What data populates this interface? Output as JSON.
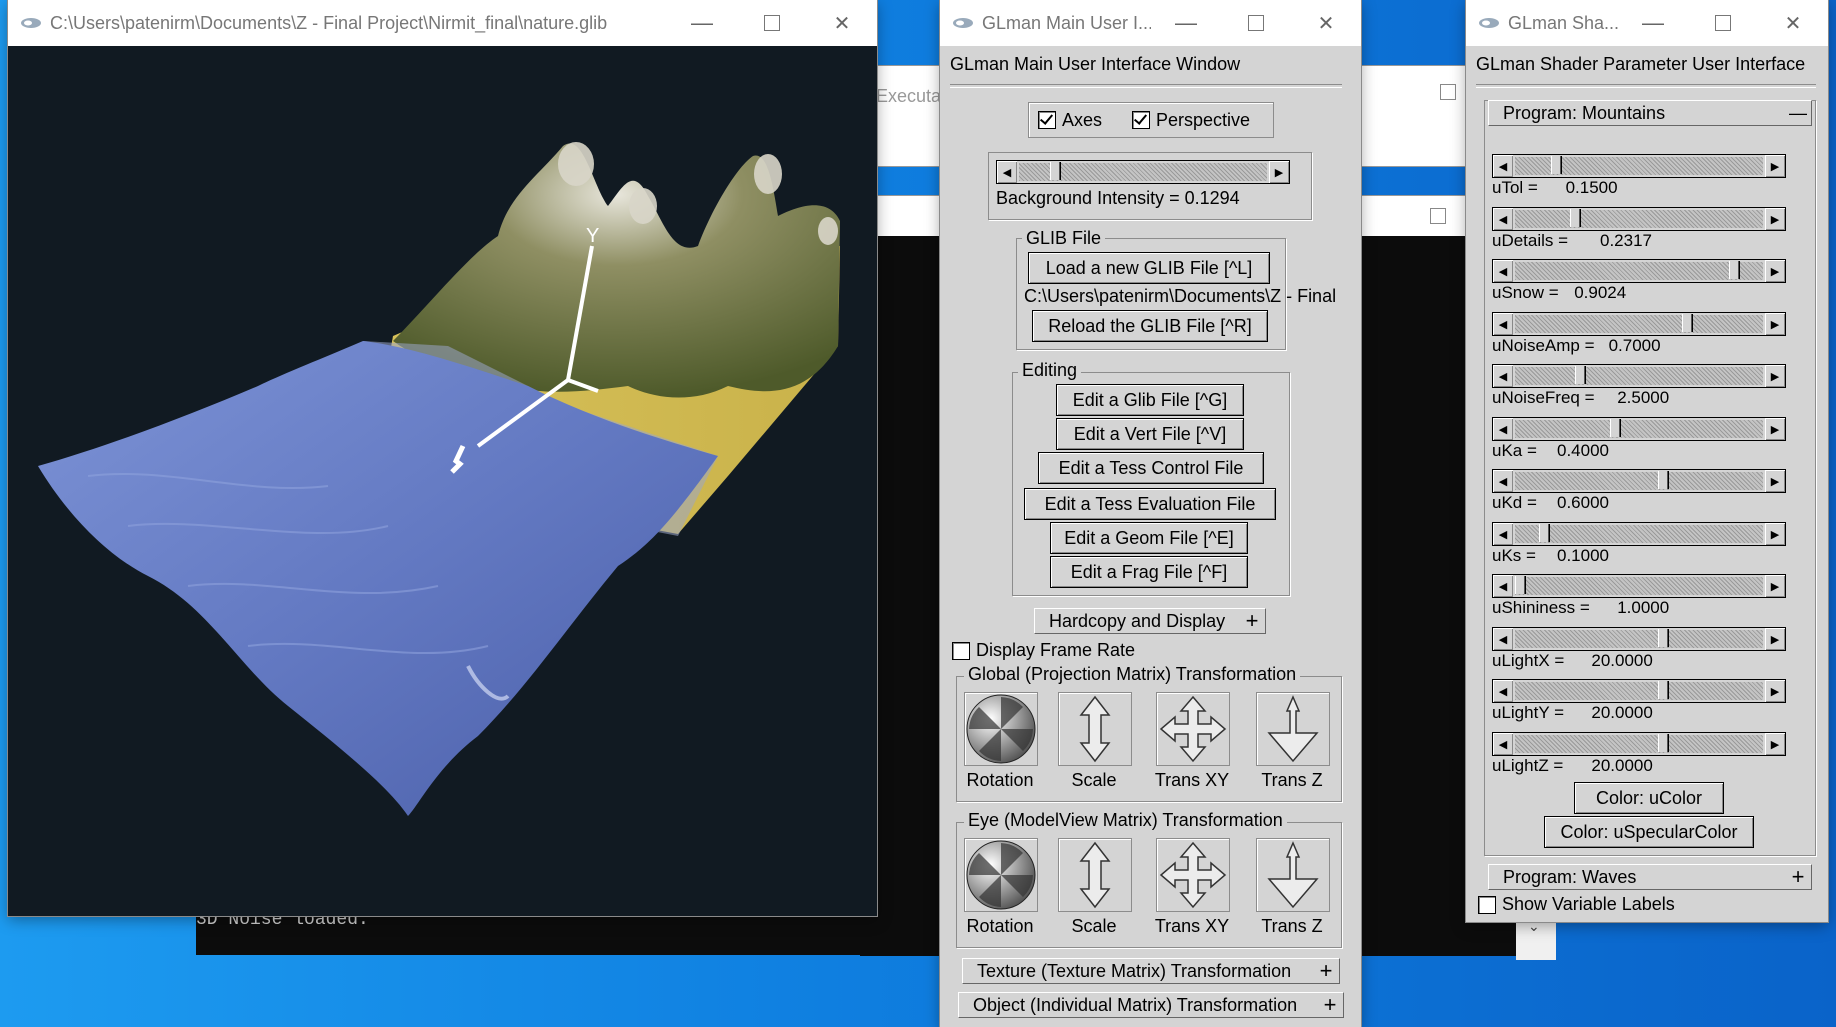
{
  "desktop": {
    "console_text": "3D Noise loaded.",
    "behind_window_text": "Executab"
  },
  "render_window": {
    "title": "C:\\Users\\patenirm\\Documents\\Z - Final Project\\Nirmit_final\\nature.glib",
    "axis_label": "Y"
  },
  "main_ui": {
    "title": "GLman Main User I...",
    "header": "GLman Main User Interface Window",
    "axes_label": "Axes",
    "axes_checked": true,
    "perspective_label": "Perspective",
    "perspective_checked": true,
    "bg_intensity_label": "Background Intensity = 0.1294",
    "bg_intensity_value": 0.1294,
    "glib_group": "GLIB File",
    "load_glib": "Load a new GLIB File [^L]",
    "glib_path": "C:\\Users\\patenirm\\Documents\\Z - Final",
    "reload_glib": "Reload the GLIB File [^R]",
    "editing_group": "Editing",
    "edit_buttons": [
      "Edit a Glib File [^G]",
      "Edit a Vert File [^V]",
      "Edit a Tess Control File",
      "Edit a Tess Evaluation File",
      "Edit a Geom File [^E]",
      "Edit a Frag File [^F]"
    ],
    "hardcopy": "Hardcopy and Display",
    "display_frame_rate": "Display Frame Rate",
    "global_group": "Global (Projection Matrix) Transformation",
    "eye_group": "Eye (ModelView Matrix) Transformation",
    "transform_labels": [
      "Rotation",
      "Scale",
      "Trans XY",
      "Trans Z"
    ],
    "texture_rollout": "Texture (Texture Matrix) Transformation",
    "object_rollout": "Object (Individual Matrix) Transformation",
    "rollout_plus": "+"
  },
  "shader_ui": {
    "title": "GLman Sha...",
    "header": "GLman Shader Parameter User Interface",
    "program_mountains": "Program: Mountains",
    "program_minus": "—",
    "params": [
      {
        "name": "uTol =",
        "value": "0.1500",
        "fraction": 0.15
      },
      {
        "name": "uDetails =",
        "value": "0.2317",
        "fraction": 0.23
      },
      {
        "name": "uSnow =",
        "value": "0.9024",
        "fraction": 0.9
      },
      {
        "name": "uNoiseAmp =",
        "value": "0.7000",
        "fraction": 0.7
      },
      {
        "name": "uNoiseFreq =",
        "value": "2.5000",
        "fraction": 0.25
      },
      {
        "name": "uKa =",
        "value": "0.4000",
        "fraction": 0.4
      },
      {
        "name": "uKd =",
        "value": "0.6000",
        "fraction": 0.6
      },
      {
        "name": "uKs =",
        "value": "0.1000",
        "fraction": 0.1
      },
      {
        "name": "uShininess =",
        "value": "1.0000",
        "fraction": 0.0
      },
      {
        "name": "uLightX =",
        "value": "20.0000",
        "fraction": 0.6
      },
      {
        "name": "uLightY =",
        "value": "20.0000",
        "fraction": 0.6
      },
      {
        "name": "uLightZ =",
        "value": "20.0000",
        "fraction": 0.6
      }
    ],
    "color_ucolor": "Color: uColor",
    "color_specular": "Color: uSpecularColor",
    "program_waves": "Program: Waves",
    "program_plus": "+",
    "show_variable_labels": "Show Variable Labels"
  }
}
